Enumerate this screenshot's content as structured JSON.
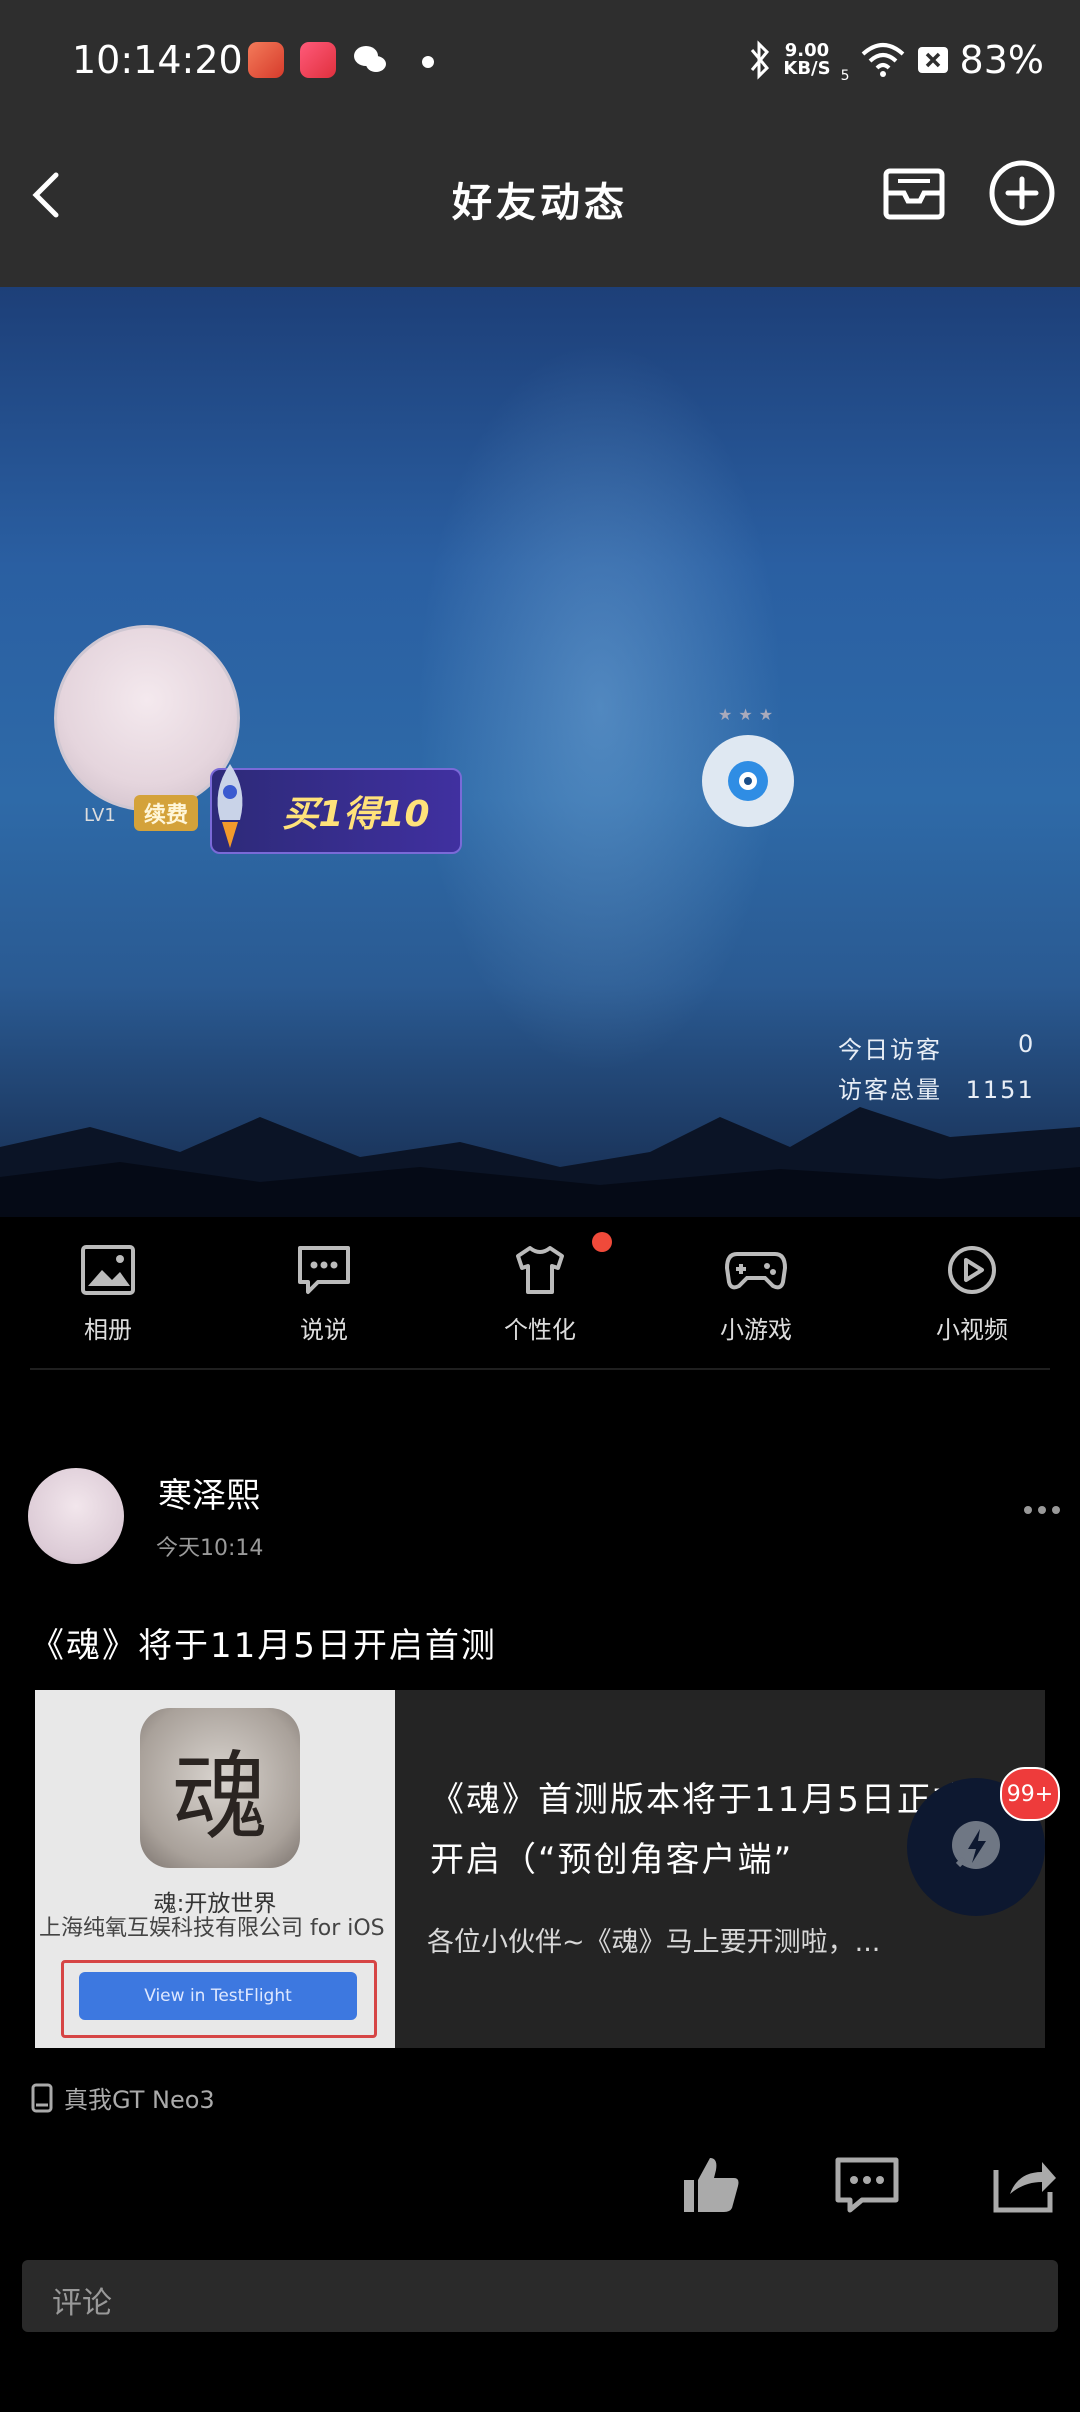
{
  "status": {
    "time": "10:14:20",
    "speed_value": "9.00",
    "speed_unit": "KB/S",
    "signal_label": "5",
    "battery": "83%"
  },
  "nav": {
    "title": "好友动态"
  },
  "cover": {
    "level": "LV1",
    "renew_label": "续费",
    "promo_text": "买1得10",
    "visitors_today_label": "今日访客",
    "visitors_today_value": "0",
    "visitors_total_label": "访客总量",
    "visitors_total_value": "1151"
  },
  "menu": [
    {
      "label": "相册",
      "icon": "album-icon"
    },
    {
      "label": "说说",
      "icon": "chat-icon"
    },
    {
      "label": "个性化",
      "icon": "shirt-icon"
    },
    {
      "label": "小游戏",
      "icon": "gamepad-icon"
    },
    {
      "label": "小视频",
      "icon": "play-icon"
    }
  ],
  "post": {
    "author": "寒泽熙",
    "time": "今天10:14",
    "text": "《魂》将于11月5日开启首测",
    "card": {
      "logo_char": "魂",
      "app_name": "魂:开放世界",
      "company": "上海纯氧互娱科技有限公司 for iOS",
      "testflight_btn": "View in TestFlight",
      "title": "《魂》首测版本将于11月5日正式开启（“预创角客户端”",
      "desc": "各位小伙伴~《魂》马上要开测啦，..."
    },
    "fab_badge": "99+",
    "device": "真我GT Neo3"
  },
  "comment": {
    "placeholder": "评论"
  },
  "colors": {
    "accent_red": "#f04a3a",
    "nav_bg": "#2e2e2e",
    "card_bg": "#242424"
  }
}
